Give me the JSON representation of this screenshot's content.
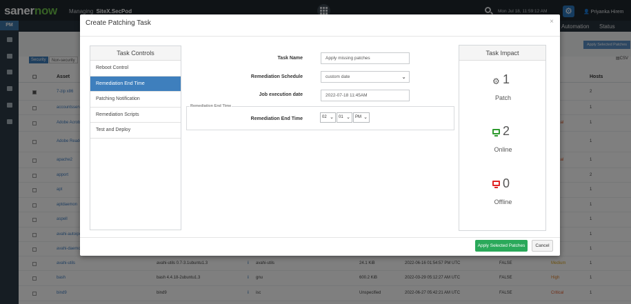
{
  "app": {
    "logo_part1": "saner",
    "logo_part2": "now",
    "managing_label": "Managing",
    "site": "SiteX.SecPod",
    "datetime": "Mon Jul 18, 11:59:12 AM",
    "user": "Priyanka Hirem"
  },
  "sidebar": {
    "active_module": "PM"
  },
  "nav": {
    "automation": "Automation",
    "status": "Status"
  },
  "toolbar": {
    "segments": [
      "Security",
      "Non-security"
    ],
    "apply_selected": "Apply Selected Patches",
    "csv": "CSV"
  },
  "table": {
    "headers": {
      "asset": "Asset",
      "hosts": "Hosts"
    },
    "rows": [
      {
        "name": "7-zip x86",
        "hosts": "2",
        "version": "",
        "info": "",
        "vendor": "",
        "size": "",
        "date": "",
        "reboot": "",
        "severity": ""
      },
      {
        "name": "accountsservice",
        "hosts": "1",
        "version": "",
        "info": "",
        "vendor": "",
        "size": "",
        "date": "",
        "reboot": "",
        "severity": ""
      },
      {
        "name": "Adobe Acrobat",
        "hosts": "1",
        "version": "",
        "info": "",
        "vendor": "",
        "size": "",
        "date": "",
        "reboot": "",
        "severity": "Critical"
      },
      {
        "name": "Adobe Reader",
        "hosts": "1",
        "version": "",
        "info": "",
        "vendor": "",
        "size": "",
        "date": "",
        "reboot": "",
        "severity": ""
      },
      {
        "name": "apache2",
        "hosts": "1",
        "version": "",
        "info": "",
        "vendor": "",
        "size": "",
        "date": "",
        "reboot": "",
        "severity": "Critical"
      },
      {
        "name": "apport",
        "hosts": "2",
        "version": "",
        "info": "",
        "vendor": "",
        "size": "",
        "date": "",
        "reboot": "",
        "severity": ""
      },
      {
        "name": "apt",
        "hosts": "1",
        "version": "",
        "info": "",
        "vendor": "",
        "size": "",
        "date": "",
        "reboot": "",
        "severity": ""
      },
      {
        "name": "aptdaemon",
        "hosts": "1",
        "version": "",
        "info": "",
        "vendor": "",
        "size": "",
        "date": "",
        "reboot": "",
        "severity": ""
      },
      {
        "name": "aspell",
        "hosts": "1",
        "version": "",
        "info": "",
        "vendor": "",
        "size": "",
        "date": "",
        "reboot": "",
        "severity": ""
      },
      {
        "name": "avahi-autoipd",
        "hosts": "1",
        "version": "",
        "info": "",
        "vendor": "",
        "size": "",
        "date": "",
        "reboot": "",
        "severity": ""
      },
      {
        "name": "avahi-daemon",
        "hosts": "1",
        "version": "",
        "info": "",
        "vendor": "",
        "size": "",
        "date": "",
        "reboot": "",
        "severity": ""
      },
      {
        "name": "avahi-utils",
        "hosts": "1",
        "version": "avahi-utils 0.7-3.1ubuntu1.3",
        "info": "i",
        "vendor": "avahi-utils",
        "size": "24.1 KiB",
        "date": "2022-06-16 01:54:57 PM UTC",
        "reboot": "FALSE",
        "severity": "Medium"
      },
      {
        "name": "bash",
        "hosts": "1",
        "version": "bash 4.4.18-2ubuntu1.3",
        "info": "i",
        "vendor": "gnu",
        "size": "600.2 KiB",
        "date": "2022-03-29 05:12:27 AM UTC",
        "reboot": "FALSE",
        "severity": "High"
      },
      {
        "name": "bind9",
        "hosts": "1",
        "version": "bind9",
        "info": "i",
        "vendor": "isc",
        "size": "Unspecified",
        "date": "2022-06-27 05:42:21 AM UTC",
        "reboot": "FALSE",
        "severity": "Critical"
      }
    ]
  },
  "modal": {
    "title": "Create Patching Task",
    "close": "×",
    "task_controls": {
      "header": "Task Controls",
      "items": [
        "Reboot Control",
        "Remediation End Time",
        "Patching Notification",
        "Remediation Scripts",
        "Test and Deploy"
      ],
      "active_index": 1
    },
    "form": {
      "task_name_label": "Task Name",
      "task_name_value": "Apply missing patches",
      "schedule_label": "Remediation Schedule",
      "schedule_value": "custom date",
      "job_date_label": "Job execution date",
      "job_date_value": "2022-07-18 11:45AM",
      "fieldset_legend": "Remediation End Time",
      "end_time_label": "Remediation End Time",
      "end_hour": "02",
      "end_minute": "01",
      "end_ampm": "PM"
    },
    "impact": {
      "header": "Task Impact",
      "patch_count": "1",
      "patch_label": "Patch",
      "online_count": "2",
      "online_label": "Online",
      "offline_count": "0",
      "offline_label": "Offline"
    },
    "footer": {
      "apply_label": "Apply Selected Patches",
      "cancel_label": "Cancel"
    }
  },
  "colors": {
    "primary_blue": "#3e7fbd",
    "apply_green": "#2aa95a",
    "online_green": "#2d9a2d",
    "offline_red": "#e02424",
    "topbar": "#1f262d"
  }
}
